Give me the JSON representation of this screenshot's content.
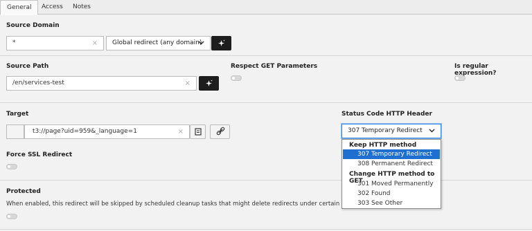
{
  "tabs": [
    "General",
    "Access",
    "Notes"
  ],
  "source_domain": {
    "label": "Source Domain",
    "value": "*",
    "select_value": "Global redirect (any domain)"
  },
  "source_path": {
    "label": "Source Path",
    "value": "/en/services-test"
  },
  "respect_get": {
    "label": "Respect GET Parameters"
  },
  "regex": {
    "label": "Is regular expression?"
  },
  "target": {
    "label": "Target",
    "value": "t3://page?uid=959&_language=1"
  },
  "status_code": {
    "label": "Status Code HTTP Header",
    "selected": "307 Temporary Redirect"
  },
  "force_ssl": {
    "label": "Force SSL Redirect"
  },
  "protected": {
    "label": "Protected",
    "help": "When enabled, this redirect will be skipped by scheduled cleanup tasks that might delete redirects under certain condit"
  },
  "dropdown": {
    "group1": "Keep HTTP method",
    "group1_options": [
      "307 Temporary Redirect",
      "308 Permanent Redirect"
    ],
    "group2": "Change HTTP method to GET",
    "group2_options": [
      "301 Moved Permanently",
      "302 Found",
      "303 See Other"
    ]
  },
  "colors": {
    "accent": "#1f6fd1",
    "magic_button": "#1d1d1d",
    "background": "#f2f2f2"
  },
  "icons": [
    "clear-icon",
    "magic-wand-icon",
    "chevron-down-icon",
    "page-icon",
    "link-icon"
  ]
}
